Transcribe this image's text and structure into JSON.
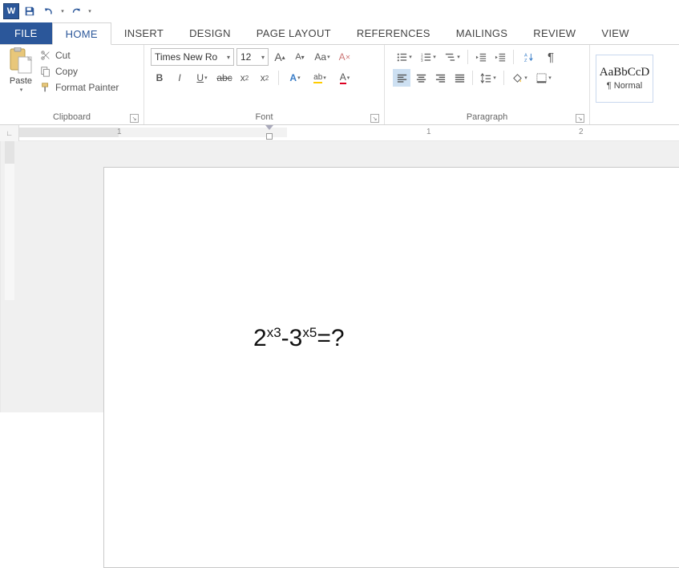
{
  "qat": {
    "app": "W"
  },
  "tabs": {
    "file": "FILE",
    "home": "HOME",
    "insert": "INSERT",
    "design": "DESIGN",
    "page_layout": "PAGE LAYOUT",
    "references": "REFERENCES",
    "mailings": "MAILINGS",
    "review": "REVIEW",
    "view": "VIEW"
  },
  "clipboard": {
    "paste": "Paste",
    "cut": "Cut",
    "copy": "Copy",
    "format_painter": "Format Painter",
    "label": "Clipboard"
  },
  "font": {
    "name": "Times New Ro",
    "size": "12",
    "label": "Font",
    "grow": "A",
    "shrink": "A",
    "case": "Aa",
    "clear": "A",
    "bold": "B",
    "italic": "I",
    "underline": "U",
    "strike": "abc",
    "sub": "x",
    "sup": "x",
    "effects": "A",
    "highlight": "ab",
    "color": "A"
  },
  "paragraph": {
    "label": "Paragraph",
    "pilcrow": "¶"
  },
  "styles": {
    "sample": "AaBbCcD",
    "name": "¶ Normal"
  },
  "ruler": {
    "n1": "1",
    "n2": "1",
    "n3": "2"
  },
  "doc": {
    "b1": "2",
    "e1": "x3",
    "m": "-3",
    "e2": "x5",
    "eq": "=?"
  }
}
